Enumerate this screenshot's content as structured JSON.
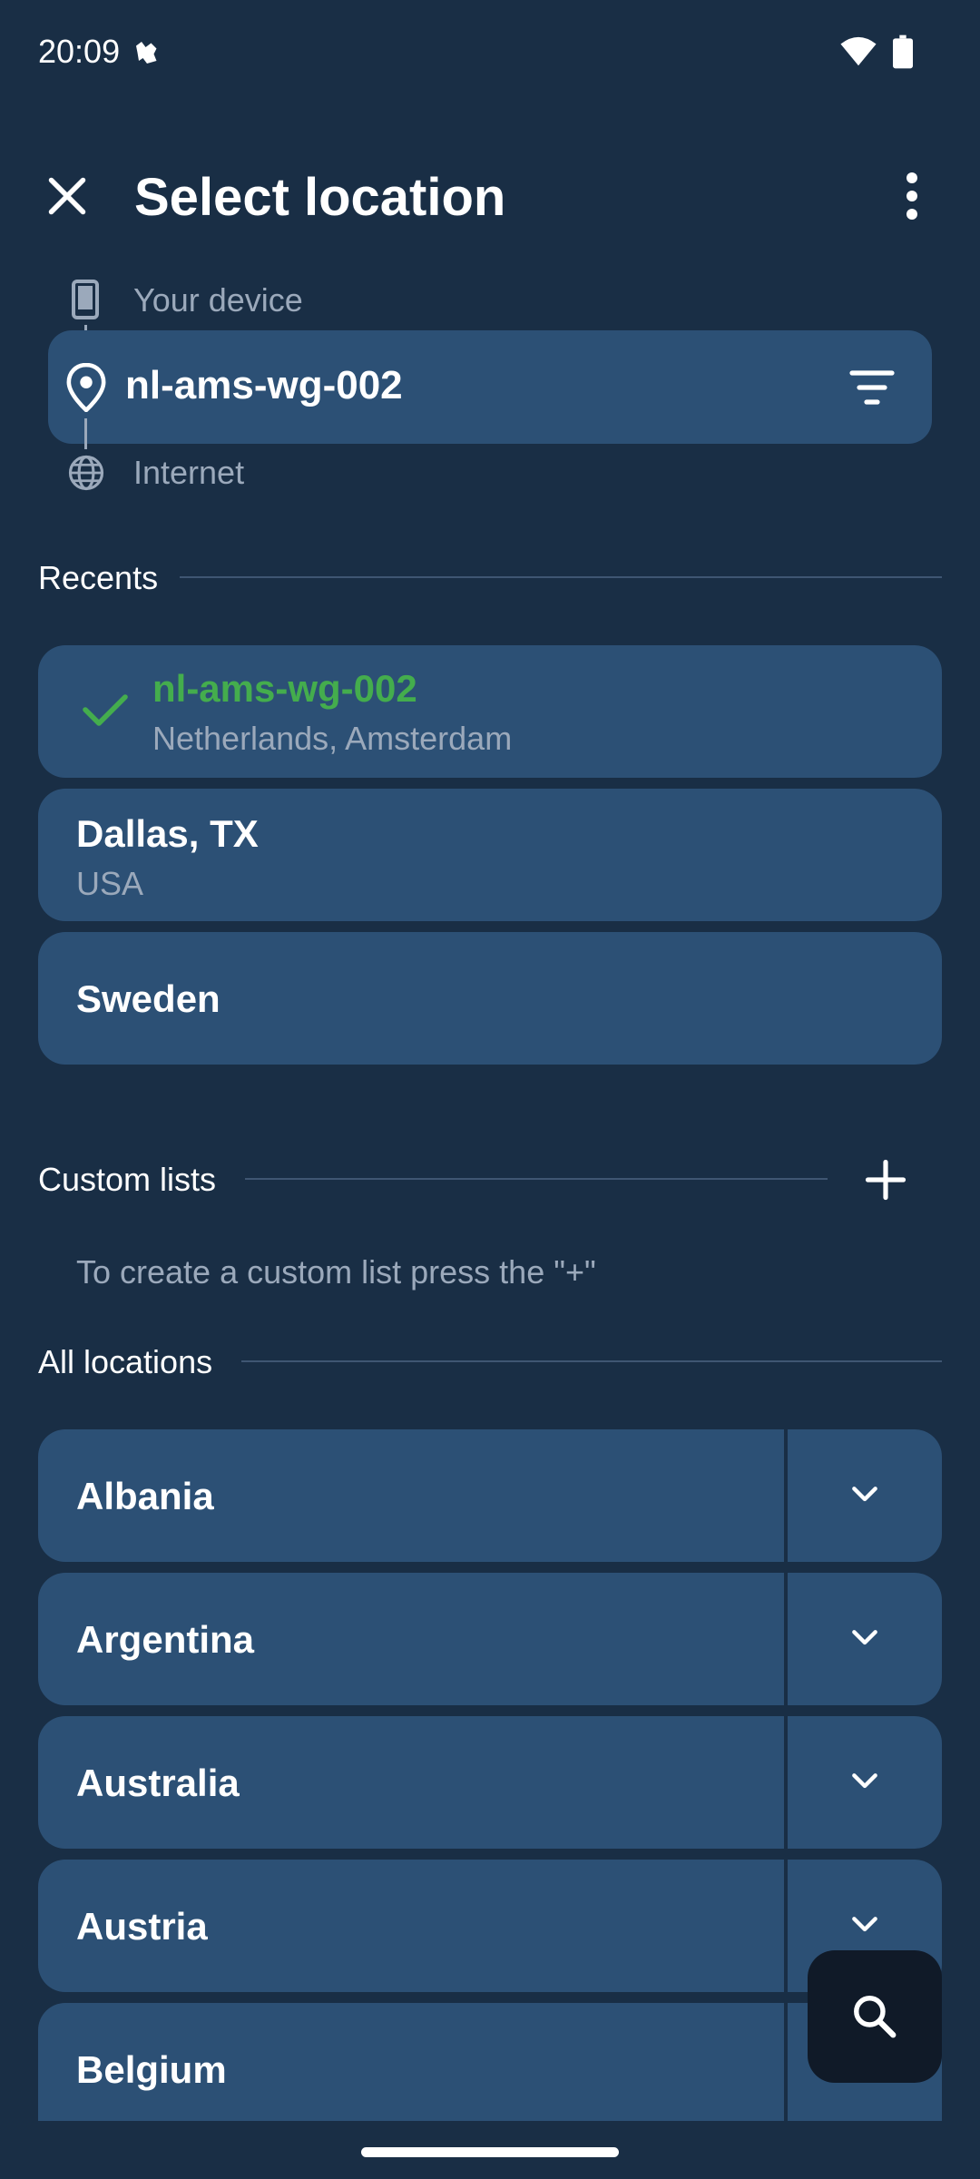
{
  "status_bar": {
    "time": "20:09"
  },
  "header": {
    "title": "Select location"
  },
  "route": {
    "device_label": "Your device",
    "selected_location": "nl-ams-wg-002",
    "internet_label": "Internet"
  },
  "recents": {
    "label": "Recents",
    "items": [
      {
        "title": "nl-ams-wg-002",
        "subtitle": "Netherlands, Amsterdam",
        "selected": true
      },
      {
        "title": "Dallas, TX",
        "subtitle": "USA"
      },
      {
        "title": "Sweden"
      }
    ]
  },
  "custom_lists": {
    "label": "Custom lists",
    "hint": "To create a custom list press the \"+\""
  },
  "all_locations": {
    "label": "All locations",
    "items": [
      "Albania",
      "Argentina",
      "Australia",
      "Austria",
      "Belgium"
    ]
  },
  "colors": {
    "background": "#192e45",
    "row": "#2c5075",
    "selected_green": "#44ad4d",
    "muted_text": "#9ba9bb"
  },
  "icons": [
    "cat-icon",
    "wifi-icon",
    "battery-icon",
    "close-icon",
    "more-vert-icon",
    "phone-icon",
    "location-pin-icon",
    "filter-icon",
    "globe-icon",
    "check-icon",
    "add-icon",
    "chevron-down-icon",
    "search-icon"
  ]
}
